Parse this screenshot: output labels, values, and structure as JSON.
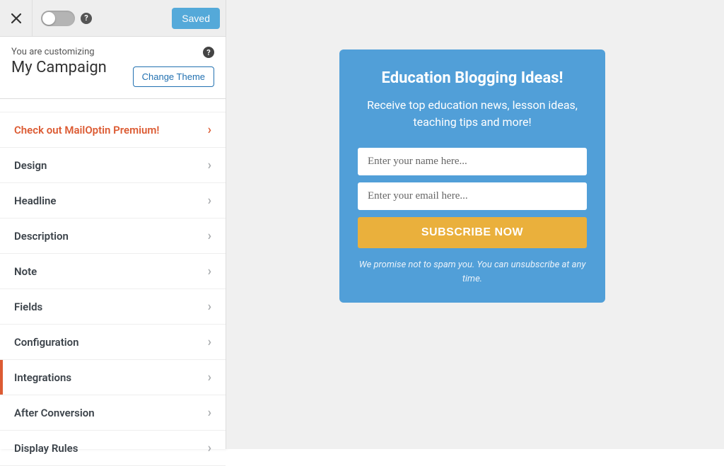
{
  "topbar": {
    "saved_label": "Saved"
  },
  "context": {
    "customizing_label": "You are customizing",
    "campaign_name": "My Campaign",
    "change_theme_label": "Change Theme"
  },
  "menu": {
    "premium_label": "Check out MailOptin Premium!",
    "items": [
      {
        "label": "Design"
      },
      {
        "label": "Headline"
      },
      {
        "label": "Description"
      },
      {
        "label": "Note"
      },
      {
        "label": "Fields"
      },
      {
        "label": "Configuration"
      },
      {
        "label": "Integrations"
      },
      {
        "label": "After Conversion"
      },
      {
        "label": "Display Rules"
      }
    ]
  },
  "optin": {
    "headline": "Education Blogging Ideas!",
    "description": "Receive top education news, lesson ideas, teaching tips and more!",
    "name_placeholder": "Enter your name here...",
    "email_placeholder": "Enter your email here...",
    "button_label": "SUBSCRIBE NOW",
    "note": "We promise not to spam you. You can unsubscribe at any time."
  }
}
